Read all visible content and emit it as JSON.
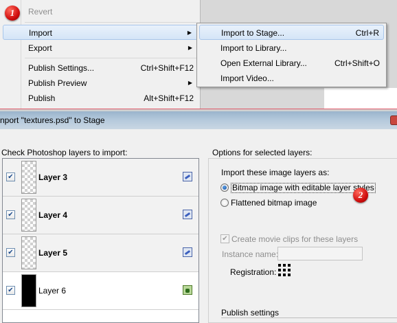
{
  "file_menu": {
    "revert": "Revert",
    "import": "Import",
    "export": "Export",
    "publish_settings": "Publish Settings...",
    "publish_settings_shortcut": "Ctrl+Shift+F12",
    "publish_preview": "Publish Preview",
    "publish": "Publish",
    "publish_shortcut": "Alt+Shift+F12",
    "arrow": "▶"
  },
  "import_submenu": {
    "import_to_stage": "Import to Stage...",
    "import_to_stage_shortcut": "Ctrl+R",
    "import_to_library": "Import to Library...",
    "open_external_library": "Open External Library...",
    "open_external_library_shortcut": "Ctrl+Shift+O",
    "import_video": "Import Video..."
  },
  "badges": {
    "step1": "1",
    "step2": "2"
  },
  "dialog": {
    "title": "nport \"textures.psd\" to Stage",
    "check_layers_label": "Check Photoshop layers to import:",
    "layers": [
      {
        "name": "Layer 3",
        "checked": "✔",
        "bold": true
      },
      {
        "name": "Layer 4",
        "checked": "✔",
        "bold": true
      },
      {
        "name": "Layer 5",
        "checked": "✔",
        "bold": true
      },
      {
        "name": "Layer 6",
        "checked": "✔",
        "bold": false
      }
    ],
    "options_label": "Options for selected layers:",
    "import_as_label": "Import these image layers as:",
    "option_bitmap_editable": "Bitmap image with editable layer styles",
    "option_flattened": "Flattened bitmap image",
    "create_movie_clips": "Create movie clips for these layers",
    "instance_name_label": "Instance name:",
    "instance_name_value": "",
    "registration_label": "Registration:",
    "publish_settings_label": "Publish settings"
  },
  "colors": {
    "badge_red": "#d10e0e",
    "menu_highlight": "#d5e5f7",
    "titlebar": "#9ab4cc"
  }
}
